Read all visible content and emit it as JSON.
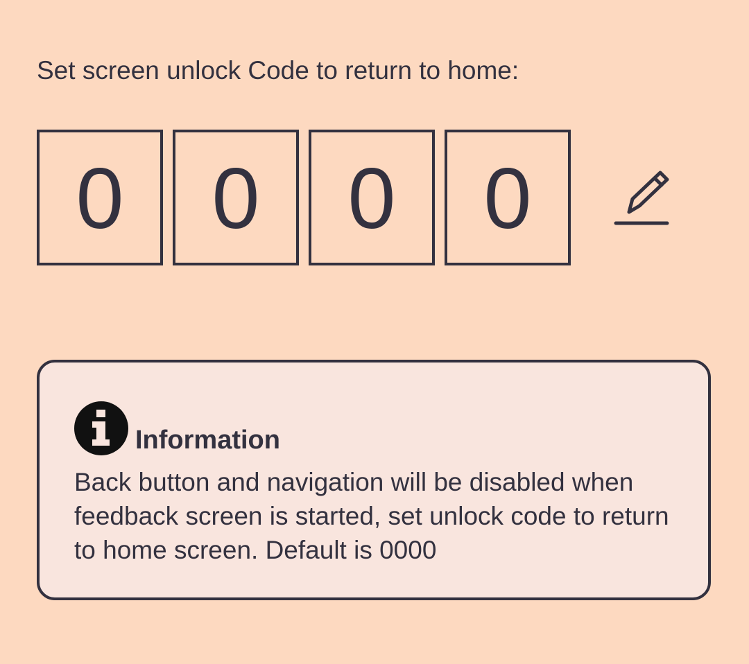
{
  "prompt": {
    "label": "Set screen unlock Code to return to home:"
  },
  "unlock_code": {
    "digits": [
      "0",
      "0",
      "0",
      "0"
    ],
    "edit_icon": "pencil-icon"
  },
  "info": {
    "icon": "info-icon",
    "title": "Information",
    "message": "Back button and navigation will be disabled when feedback screen is started, set unlock code to return to home screen. Default is 0000"
  },
  "colors": {
    "background": "#fdd9c0",
    "card_background": "#f9e5de",
    "text": "#33313f"
  }
}
